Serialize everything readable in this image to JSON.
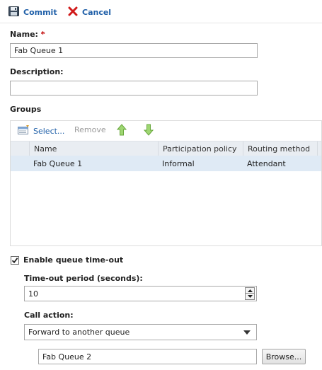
{
  "toolbar": {
    "commit_label": "Commit",
    "cancel_label": "Cancel"
  },
  "form": {
    "name_label": "Name:",
    "required_mark": "*",
    "name_value": "Fab Queue 1",
    "description_label": "Description:",
    "description_value": ""
  },
  "groups": {
    "section_label": "Groups",
    "select_label": "Select...",
    "remove_label": "Remove",
    "columns": [
      "Name",
      "Participation policy",
      "Routing method"
    ],
    "rows": [
      {
        "name": "Fab Queue 1",
        "participation_policy": "Informal",
        "routing_method": "Attendant"
      }
    ]
  },
  "timeout": {
    "enable_label": "Enable queue time-out",
    "enabled": true,
    "period_label": "Time-out period (seconds):",
    "period_value": "10",
    "call_action_label": "Call action:",
    "call_action_value": "Forward to another queue",
    "target_queue_value": "Fab Queue 2",
    "browse_label": "Browse..."
  },
  "colors": {
    "link_blue": "#1f5fa8",
    "cancel_red": "#d11a1a",
    "selected_row": "#dfeaf5",
    "header_bg": "#e9edf2",
    "arrow_green": "#7ac24e"
  }
}
